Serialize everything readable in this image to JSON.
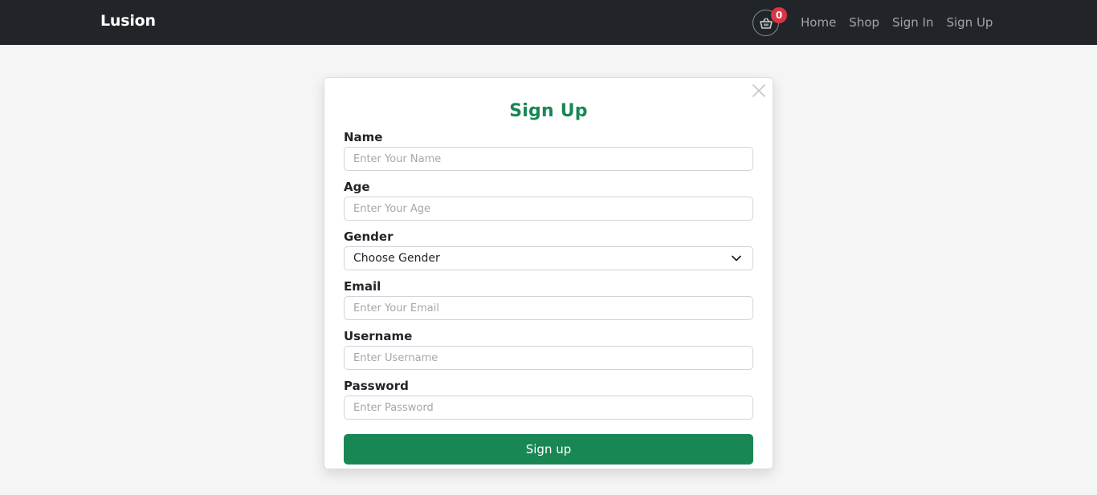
{
  "navbar": {
    "brand": "Lusion",
    "cart_count": "0",
    "cart_icon": "basket-icon",
    "links": [
      {
        "label": "Home"
      },
      {
        "label": "Shop"
      },
      {
        "label": "Sign In"
      },
      {
        "label": "Sign Up"
      }
    ]
  },
  "modal": {
    "title": "Sign Up",
    "close_icon": "close-icon",
    "fields": {
      "name": {
        "label": "Name",
        "placeholder": "Enter Your Name"
      },
      "age": {
        "label": "Age",
        "placeholder": "Enter Your Age"
      },
      "gender": {
        "label": "Gender",
        "selected": "Choose Gender"
      },
      "email": {
        "label": "Email",
        "placeholder": "Enter Your Email"
      },
      "username": {
        "label": "Username",
        "placeholder": "Enter Username"
      },
      "password": {
        "label": "Password",
        "placeholder": "Enter Password"
      }
    },
    "submit_label": "Sign up"
  },
  "colors": {
    "navbar_bg": "#212529",
    "accent": "#198754",
    "badge": "#dc3545",
    "page_bg": "#f5f5f5"
  }
}
